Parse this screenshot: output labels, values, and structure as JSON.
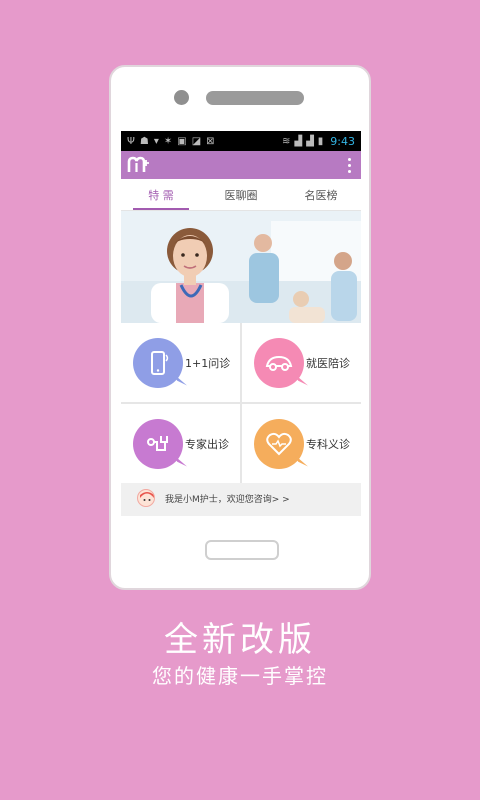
{
  "statusbar": {
    "time": "9:43"
  },
  "tabs": [
    {
      "label": "特  需"
    },
    {
      "label": "医聊圈"
    },
    {
      "label": "名医榜"
    }
  ],
  "grid": [
    {
      "label": "1+1问诊",
      "icon": "phone-icon",
      "color": "#8f9ee6"
    },
    {
      "label": "就医陪诊",
      "icon": "car-icon",
      "color": "#f58ab4"
    },
    {
      "label": "专家出诊",
      "icon": "stethoscope-icon",
      "color": "#c77ad1"
    },
    {
      "label": "专科义诊",
      "icon": "heart-pulse-icon",
      "color": "#f5ad5c"
    }
  ],
  "footer": {
    "text": "我是小M护士，欢迎您咨询> >"
  },
  "promo": {
    "headline": "全新改版",
    "subline": "您的健康一手掌控"
  },
  "colors": {
    "background": "#e69acb",
    "appbar": "#b77ac2",
    "accent": "#a25bb0"
  }
}
